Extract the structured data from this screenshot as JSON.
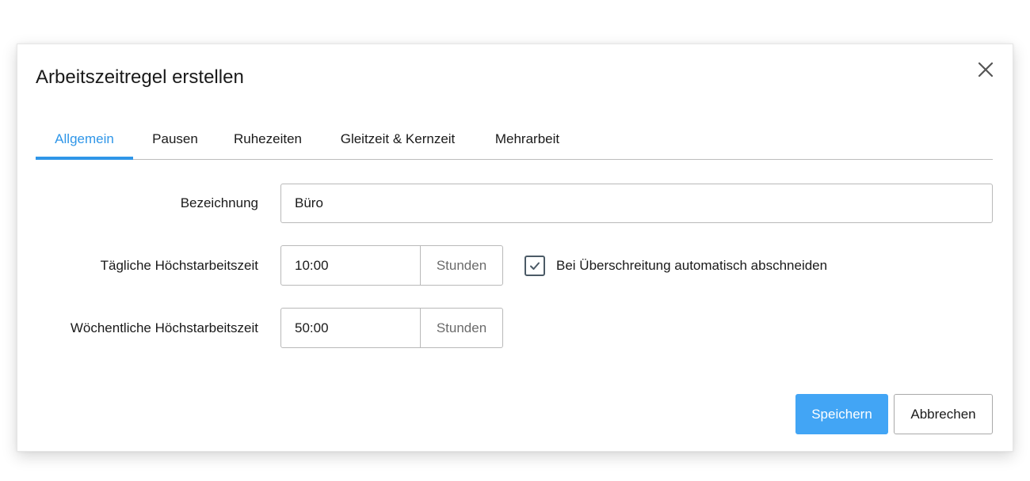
{
  "dialog": {
    "title": "Arbeitszeitregel erstellen",
    "close_icon": "close-icon"
  },
  "tabs": [
    {
      "label": "Allgemein",
      "active": true
    },
    {
      "label": "Pausen",
      "active": false
    },
    {
      "label": "Ruhezeiten",
      "active": false
    },
    {
      "label": "Gleitzeit & Kernzeit",
      "active": false
    },
    {
      "label": "Mehrarbeit",
      "active": false
    }
  ],
  "form": {
    "name": {
      "label": "Bezeichnung",
      "value": "Büro"
    },
    "daily_max": {
      "label": "Tägliche Höchstarbeitszeit",
      "value": "10:00",
      "unit": "Stunden"
    },
    "weekly_max": {
      "label": "Wöchentliche Höchstarbeitszeit",
      "value": "50:00",
      "unit": "Stunden"
    },
    "auto_cut": {
      "label": "Bei Überschreitung automatisch abschneiden",
      "checked": true,
      "icon": "checkmark-icon"
    }
  },
  "buttons": {
    "save": "Speichern",
    "cancel": "Abbrechen"
  },
  "colors": {
    "accent": "#2f96e8",
    "primary_button": "#42a5f5",
    "checkbox_border": "#4b5a66"
  }
}
